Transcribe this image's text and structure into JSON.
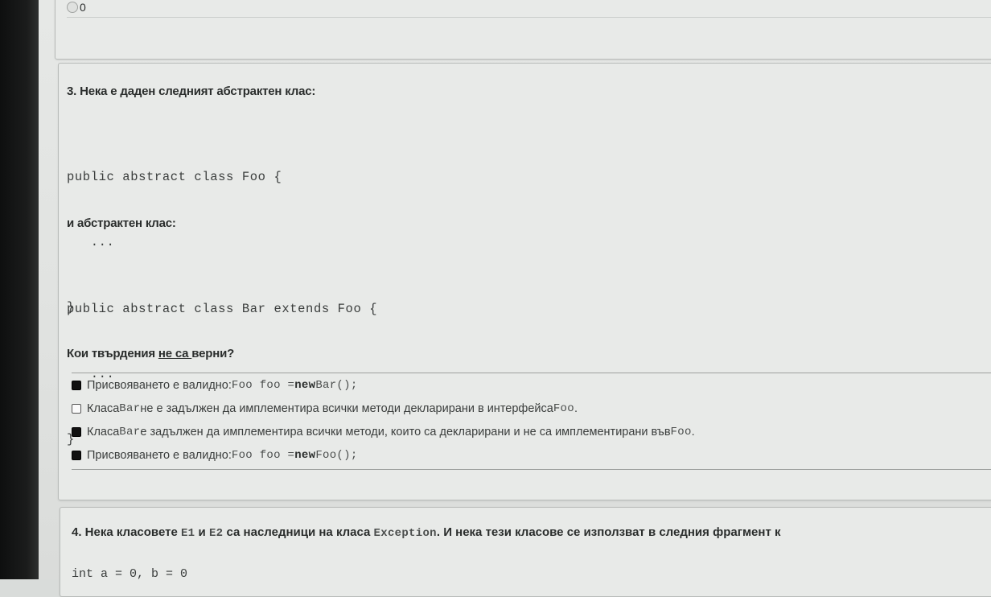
{
  "previous_question": {
    "option_label": "0"
  },
  "question3": {
    "title": "3. Нека е даден следният абстрактен клас:",
    "code1": [
      "public abstract class Foo {",
      "   ...",
      "}"
    ],
    "subhead": "и абстрактен клас:",
    "code2": [
      "public abstract class Bar extends Foo {",
      "   ...",
      "}"
    ],
    "prompt": {
      "before": "Кои твърдения ",
      "underlined": "не са ",
      "after": "верни?"
    },
    "options": [
      {
        "checked": true,
        "text1": "Присвояването е валидно: ",
        "code1": "Foo foo = ",
        "keyword": "new",
        "code2": " Bar();"
      },
      {
        "checked": false,
        "text1": "Класа ",
        "code1": "Bar",
        "text2": " не е задължен да имплементира всички методи декларирани в интерфейса ",
        "code2": "Foo",
        "text3": "."
      },
      {
        "checked": true,
        "text1": "Класа ",
        "code1": "Bar",
        "text2": " е задължен да имплементира всички методи, които са декларирани и не са имплементирани във ",
        "code2": "Foo",
        "text3": "."
      },
      {
        "checked": true,
        "text1": "Присвояването е валидно: ",
        "code1": "Foo foo = ",
        "keyword": "new",
        "code2": " Foo();"
      }
    ]
  },
  "question4": {
    "title_part1": "4. Нека класовете ",
    "code_e1": "E1",
    "title_and": " и ",
    "code_e2": "E2",
    "title_part2": " са наследници на класа ",
    "code_exception": "Exception",
    "title_part3": ". И нека тези класове се използват в следния фрагмент к",
    "code_start": "int a = 0, b = 0"
  }
}
